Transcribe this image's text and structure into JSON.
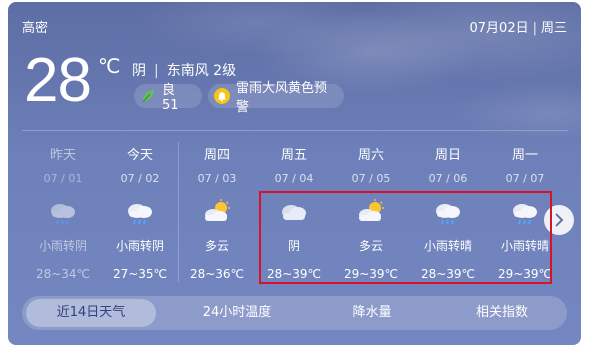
{
  "location": {
    "city": "高密"
  },
  "date": {
    "date": "07月02日",
    "weekday": "周三"
  },
  "current": {
    "temperature": "28",
    "unit": "℃",
    "condition": "阴",
    "wind": "东南风 2级",
    "aqi_label": "良 51",
    "alert": "雷雨大风黄色预警"
  },
  "forecast": [
    {
      "day": "昨天",
      "date": "07 / 01",
      "icon": "light-rain-icon",
      "desc": "小雨转阴",
      "temp": "28~34℃",
      "past": true
    },
    {
      "day": "今天",
      "date": "07 / 02",
      "icon": "light-rain-icon",
      "desc": "小雨转阴",
      "temp": "27~35℃"
    },
    {
      "day": "周四",
      "date": "07 / 03",
      "icon": "partly-cloudy-icon",
      "desc": "多云",
      "temp": "28~36℃"
    },
    {
      "day": "周五",
      "date": "07 / 04",
      "icon": "overcast-icon",
      "desc": "阴",
      "temp": "28~39℃"
    },
    {
      "day": "周六",
      "date": "07 / 05",
      "icon": "partly-cloudy-icon",
      "desc": "多云",
      "temp": "29~39℃"
    },
    {
      "day": "周日",
      "date": "07 / 06",
      "icon": "light-rain-icon",
      "desc": "小雨转晴",
      "temp": "28~39℃"
    },
    {
      "day": "周一",
      "date": "07 / 07",
      "icon": "light-rain-icon",
      "desc": "小雨转晴",
      "temp": "29~39℃"
    }
  ],
  "tabs": [
    "近14日天气",
    "24小时温度",
    "降水量",
    "相关指数"
  ],
  "colors": {
    "highlight": "#d8122a",
    "card": "#6475ad",
    "leaf": "#5fc05c",
    "alert": "#f5c518"
  }
}
